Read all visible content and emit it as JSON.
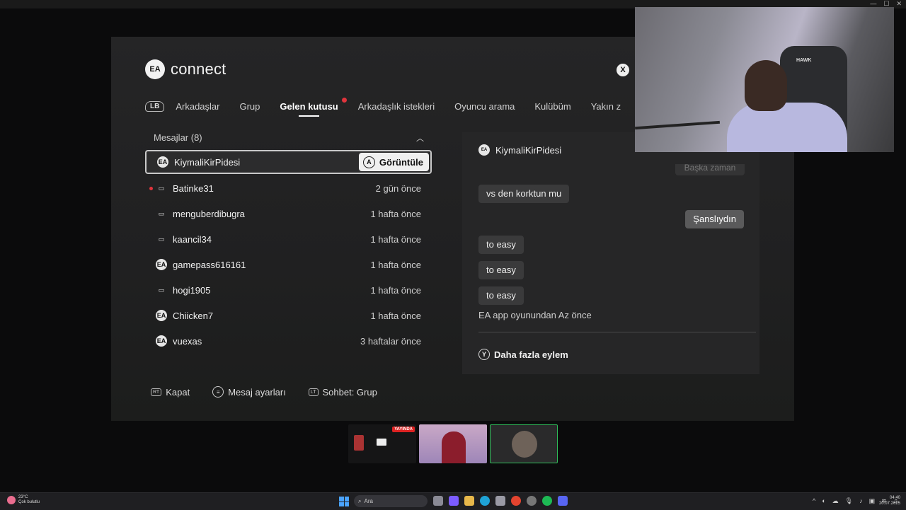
{
  "app": {
    "logo_badge": "EA",
    "logo_text": "connect"
  },
  "tabs": {
    "bumper": "LB",
    "items": [
      {
        "label": "Arkadaşlar"
      },
      {
        "label": "Grup"
      },
      {
        "label": "Gelen kutusu"
      },
      {
        "label": "Arkadaşlık istekleri"
      },
      {
        "label": "Oyuncu arama"
      },
      {
        "label": "Kulübüm"
      },
      {
        "label": "Yakın z"
      }
    ]
  },
  "messages": {
    "header": "Mesajlar (8)",
    "view_button": {
      "badge": "A",
      "label": "Görüntüle"
    },
    "rows": [
      {
        "name": "KiymaliKirPidesi",
        "time": ""
      },
      {
        "name": "Batinke31",
        "time": "2 gün önce"
      },
      {
        "name": "menguberdibugra",
        "time": "1 hafta önce"
      },
      {
        "name": "kaancil34",
        "time": "1 hafta önce"
      },
      {
        "name": "gamepass616161",
        "time": "1 hafta önce"
      },
      {
        "name": "hogi1905",
        "time": "1 hafta önce"
      },
      {
        "name": "Chiicken7",
        "time": "1 hafta önce"
      },
      {
        "name": "vuexas",
        "time": "3 haftalar önce"
      }
    ]
  },
  "chat": {
    "partner": "KiymaliKirPidesi",
    "faded_message": "Başka zaman",
    "bubbles": [
      {
        "text": "vs den korktun mu"
      },
      {
        "text": "Şanslıydın"
      },
      {
        "text": "to easy"
      },
      {
        "text": "to easy"
      },
      {
        "text": "to easy"
      }
    ],
    "meta": "EA app oyunundan Az önce",
    "more": {
      "badge": "Y",
      "label": "Daha fazla eylem"
    }
  },
  "footer": {
    "close": {
      "badge": "RT",
      "label": "Kapat"
    },
    "settings": {
      "label": "Mesaj ayarları"
    },
    "chat_group": {
      "badge": "LT",
      "label": "Sohbet: Grup"
    }
  },
  "webcam": {
    "chair_logo": "HAWK"
  },
  "thumbnails": {
    "live_badge": "YAYINDA"
  },
  "taskbar": {
    "weather_temp": "23°C",
    "weather_desc": "Çok bulutlu",
    "search": "Ara",
    "time": "04:40",
    "date": "20.07.2025"
  }
}
